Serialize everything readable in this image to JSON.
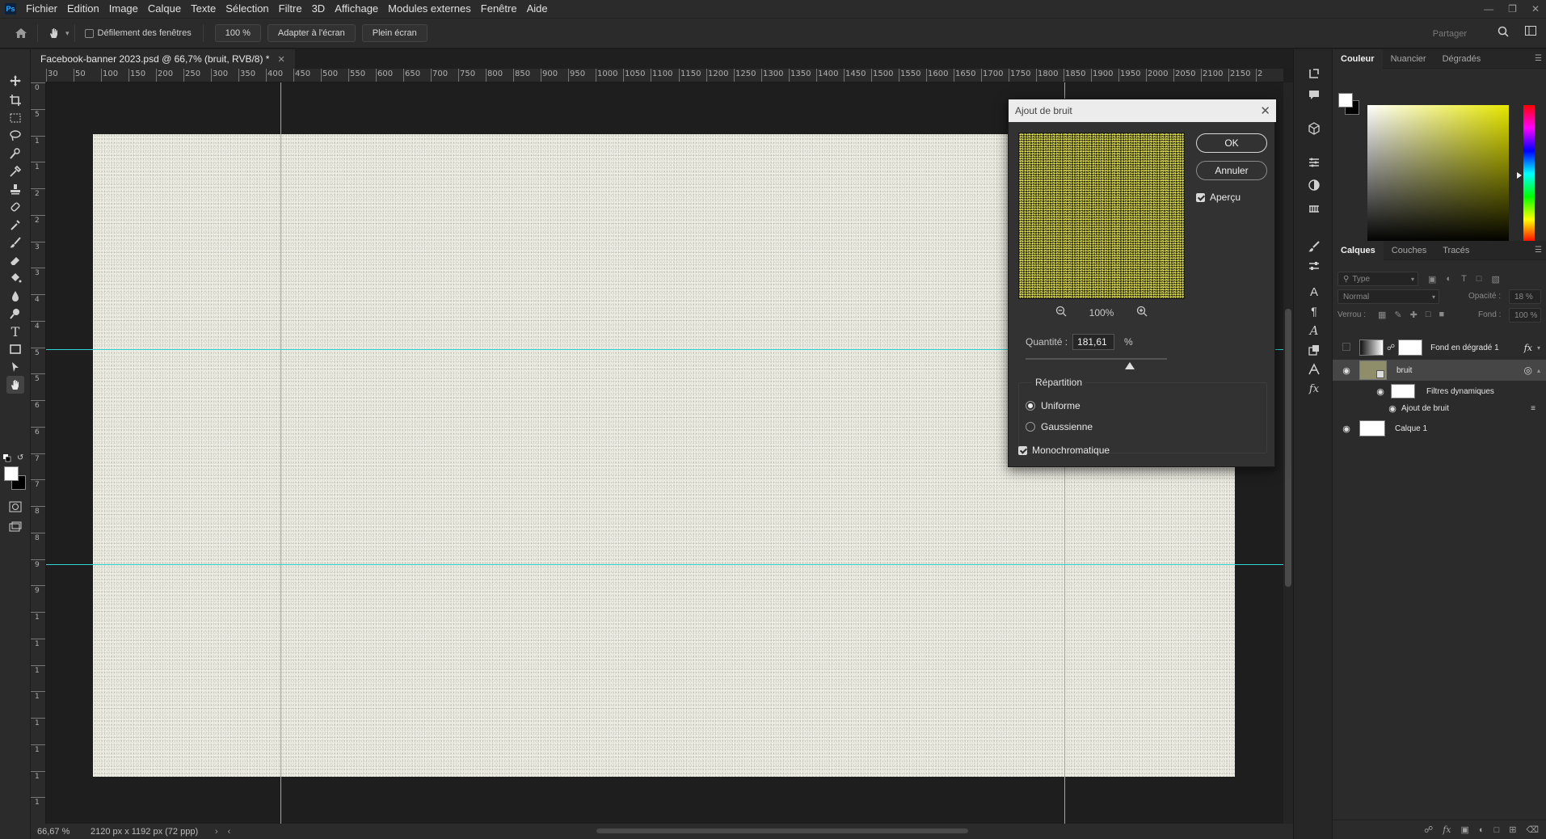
{
  "app": {
    "logo": "Ps",
    "menu": [
      "Fichier",
      "Edition",
      "Image",
      "Calque",
      "Texte",
      "Sélection",
      "Filtre",
      "3D",
      "Affichage",
      "Modules externes",
      "Fenêtre",
      "Aide"
    ]
  },
  "options_bar": {
    "scroll_all_windows": "Défilement des fenêtres",
    "zoom_value": "100 %",
    "fit_screen": "Adapter à l'écran",
    "full_screen": "Plein écran",
    "share": "Partager"
  },
  "document": {
    "tab_title": "Facebook-banner 2023.psd @ 66,7% (bruit, RVB/8) *",
    "zoom_status": "66,67 %",
    "size_status": "2120 px x 1192 px (72 ppp)"
  },
  "ruler": {
    "h_labels": [
      "30",
      "50",
      "100",
      "150",
      "200",
      "250",
      "300",
      "350",
      "400",
      "450",
      "500",
      "550",
      "600",
      "650",
      "700",
      "750",
      "800",
      "850",
      "900",
      "950",
      "1000",
      "1050",
      "1100",
      "1150",
      "1200",
      "1250",
      "1300",
      "1350",
      "1400",
      "1450",
      "1500",
      "1550",
      "1600",
      "1650",
      "1700",
      "1750",
      "1800",
      "1850",
      "1900",
      "1950",
      "2000",
      "2050",
      "2100",
      "2150",
      "2"
    ],
    "v_labels": [
      "0",
      "5",
      "1",
      "1",
      "2",
      "2",
      "3",
      "3",
      "4",
      "4",
      "5",
      "5",
      "6",
      "6",
      "7",
      "7",
      "8",
      "8",
      "9",
      "9",
      "1",
      "1",
      "1",
      "1",
      "1",
      "1",
      "1",
      "1"
    ]
  },
  "dialog": {
    "title": "Ajout de bruit",
    "ok": "OK",
    "cancel": "Annuler",
    "preview_label": "Aperçu",
    "preview_checked": true,
    "zoom": "100%",
    "quantity_label": "Quantité :",
    "quantity_value": "181,61",
    "quantity_unit": "%",
    "distribution_label": "Répartition",
    "uniform": "Uniforme",
    "gaussian": "Gaussienne",
    "selected_distribution": "uniform",
    "monochromatic": "Monochromatique",
    "monochromatic_checked": true
  },
  "color_panel": {
    "tabs": [
      "Couleur",
      "Nuancier",
      "Dégradés"
    ],
    "active_tab": "Couleur",
    "foreground": "#ffffff",
    "background": "#000000"
  },
  "layers_panel": {
    "tabs": [
      "Calques",
      "Couches",
      "Tracés"
    ],
    "active_tab": "Calques",
    "filter_placeholder": "Type",
    "blend_mode": "Normal",
    "opacity_label": "Opacité :",
    "opacity_value": "18 %",
    "lock_label": "Verrou :",
    "fill_label": "Fond :",
    "fill_value": "100 %",
    "layers": [
      {
        "name": "Fond en dégradé 1",
        "visible": false,
        "selected": false,
        "fx": "fx"
      },
      {
        "name": "bruit",
        "visible": true,
        "selected": true
      },
      {
        "name": "Filtres dynamiques",
        "visible": true,
        "sub": true
      },
      {
        "name": "Ajout de bruit",
        "visible": true,
        "sub2": true
      },
      {
        "name": "Calque 1",
        "visible": true,
        "selected": false
      }
    ]
  },
  "colors": {
    "guide": "#2fd3d3",
    "canvas_fill": "#e6e5d9",
    "accent_panel": "#2b2b2b"
  }
}
